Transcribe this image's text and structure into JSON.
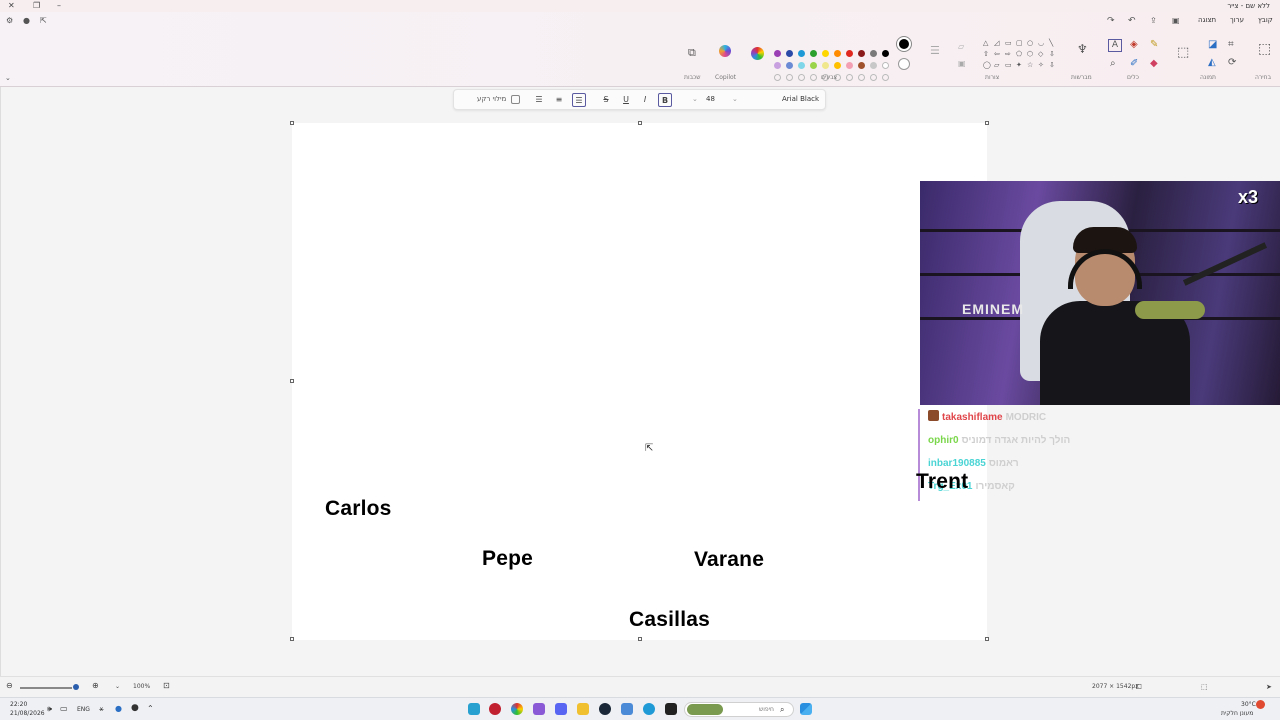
{
  "window": {
    "title": "ללא שם - צייר"
  },
  "menu": {
    "items": [
      "קובץ",
      "ערוך",
      "תצוגה"
    ]
  },
  "ribbon": {
    "groups": {
      "canvas": "בחירה",
      "image": "תמונה",
      "tools": "כלים",
      "brushes": "מברשות",
      "shapes": "צורות",
      "colors": "צבעים",
      "copilot": "Copilot",
      "layers": "שכבות"
    },
    "palette_row1": [
      "#000000",
      "#7a7a7a",
      "#8b1a1a",
      "#e0281e",
      "#ff8c00",
      "#ffd700",
      "#2ca02c",
      "#1f9ad6",
      "#2b4aa8",
      "#9a3fb4"
    ],
    "palette_row2": [
      "#ffffff",
      "#c8c8c8",
      "#a0522d",
      "#f4a0b4",
      "#ffc000",
      "#f0e68c",
      "#9ad44a",
      "#7fd6e8",
      "#6b8bd4",
      "#c8a0e0"
    ]
  },
  "text_toolbar": {
    "font_name": "Arial Black",
    "font_size": "48",
    "bold_label": "B",
    "italic_label": "I",
    "underline_label": "U",
    "strike_label": "S",
    "fill_background_label": "מילוי רקע"
  },
  "canvas": {
    "players": [
      {
        "name": "Carlos"
      },
      {
        "name": "Pepe"
      },
      {
        "name": "Varane"
      },
      {
        "name": "Casillas"
      },
      {
        "name": "Trent"
      }
    ]
  },
  "stream": {
    "shirt_text": "EMINEM",
    "badge": "x3",
    "chat": [
      {
        "user": "takashiflame",
        "message": "MODRIC",
        "color": "#e0454a"
      },
      {
        "user": "ophir0",
        "message": "הולך להיות אגדה דמוניס",
        "color": "#7ad64a"
      },
      {
        "user": "inbar190885",
        "message": "ראמוס",
        "color": "#4ad4d4"
      },
      {
        "user": "Trg_Ex01",
        "message": "קאסמירו",
        "color": "#4ad4d4"
      }
    ]
  },
  "status": {
    "zoom": "100%",
    "dimensions": "2077 × 1542px"
  },
  "taskbar": {
    "time": "22:20",
    "date": "21/08/2026",
    "language": "ENG",
    "search_placeholder": "חיפוש",
    "weather_temp": "30°C",
    "weather_desc": "מעונן חלקית"
  }
}
